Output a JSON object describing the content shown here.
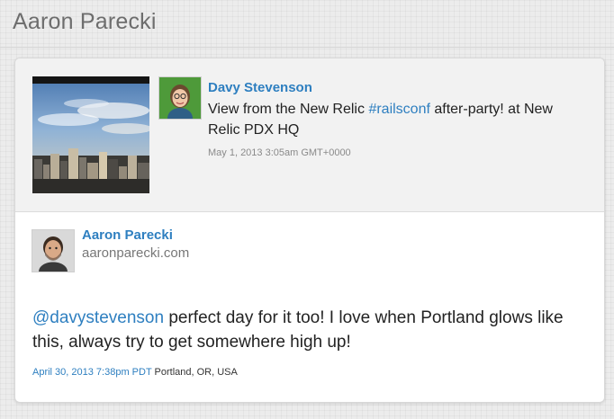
{
  "page": {
    "title": "Aaron Parecki"
  },
  "quoted_post": {
    "author_name": "Davy Stevenson",
    "text_before": "View from the New Relic ",
    "hashtag": "#railsconf",
    "text_after": " after-party! at New Relic PDX HQ",
    "date": "May 1, 2013 3:05am GMT+0000",
    "photo_icon": "city-skyline-photo",
    "avatar_icon": "davy-avatar"
  },
  "reply": {
    "author_name": "Aaron Parecki",
    "author_url": "aaronparecki.com",
    "mention": "@davystevenson",
    "text": " perfect day for it too! I love when Portland glows like this, always try to get somewhere high up!",
    "date": "April 30, 2013 7:38pm PDT",
    "location": "Portland, OR, USA",
    "avatar_icon": "aaron-avatar"
  },
  "colors": {
    "link": "#2e7fc0",
    "background": "#ececec",
    "title": "#6d6d6d"
  }
}
